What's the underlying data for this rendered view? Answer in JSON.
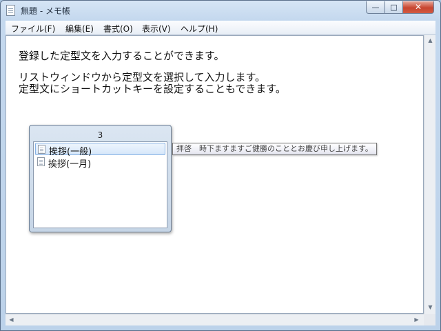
{
  "window": {
    "title": "無題 - メモ帳",
    "controls": {
      "minimize": "—",
      "maximize": "□",
      "close": "✕"
    }
  },
  "menu": [
    {
      "label": "ファイル(F)"
    },
    {
      "label": "編集(E)"
    },
    {
      "label": "書式(O)"
    },
    {
      "label": "表示(V)"
    },
    {
      "label": "ヘルプ(H)"
    }
  ],
  "editor": {
    "lines": [
      "登録した定型文を入力することができます。",
      "リストウィンドウから定型文を選択して入力します。",
      "定型文にショートカットキーを設定することもできます。"
    ]
  },
  "popup": {
    "header": "3",
    "items": [
      {
        "label": "挨拶(一般)",
        "selected": true
      },
      {
        "label": "挨拶(一月)",
        "selected": false
      }
    ]
  },
  "tooltip": {
    "text": "拝啓　時下ますますご健勝のこととお慶び申し上げます。"
  },
  "scrollbar": {
    "up": "▲",
    "down": "▼",
    "left": "◀",
    "right": "▶"
  },
  "colors": {
    "selection": "#d6e7fa",
    "close_button": "#c7452f",
    "window_frame": "#c4d8ee"
  }
}
